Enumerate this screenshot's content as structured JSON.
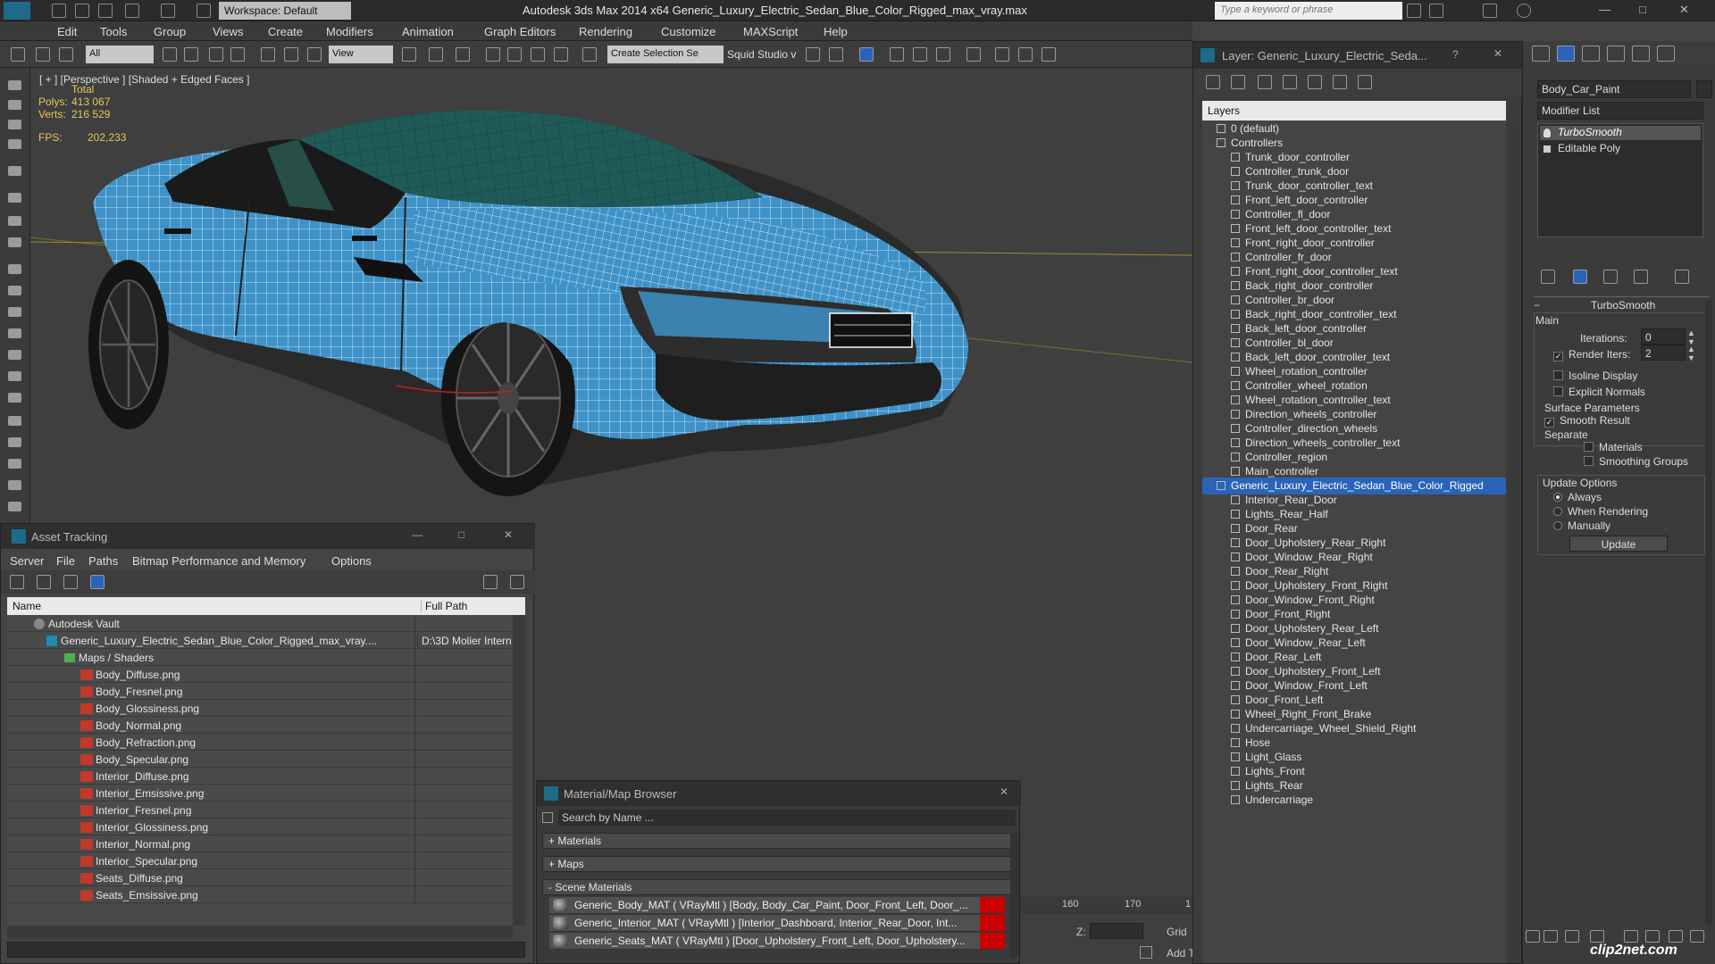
{
  "window": {
    "title": "Autodesk 3ds Max  2014 x64      Generic_Luxury_Electric_Sedan_Blue_Color_Rigged_max_vray.max",
    "workspace": "Workspace: Default",
    "search_placeholder": "Type a keyword or phrase"
  },
  "menu": [
    "Edit",
    "Tools",
    "Group",
    "Views",
    "Create",
    "Modifiers",
    "Animation",
    "Graph Editors",
    "Rendering",
    "Customize",
    "MAXScript",
    "Help"
  ],
  "toolbar": {
    "filter": "All",
    "coord": "View",
    "selection_set": "Create Selection Se",
    "squid": "Squid Studio v"
  },
  "viewport": {
    "label": "[ + ] [Perspective ] [Shaded + Edged Faces ]",
    "total_label": "Total",
    "polys_label": "Polys:",
    "polys_value": "413 067",
    "verts_label": "Verts:",
    "verts_value": "216 529",
    "fps_label": "FPS:",
    "fps_value": "202,233"
  },
  "timeline": {
    "t1": "160",
    "t2": "170",
    "t3": "1",
    "z_label": "Z:",
    "grid_label": "Grid",
    "add_label": "Add T"
  },
  "asset_tracking": {
    "title": "Asset Tracking",
    "menu": [
      "Server",
      "File",
      "Paths",
      "Bitmap Performance and Memory",
      "Options"
    ],
    "col_name": "Name",
    "col_path": "Full Path",
    "vault": "Autodesk Vault",
    "file": "Generic_Luxury_Electric_Sedan_Blue_Color_Rigged_max_vray....",
    "file_path": "D:\\3D Molier Intern",
    "maps_folder": "Maps / Shaders",
    "maps": [
      "Body_Diffuse.png",
      "Body_Fresnel.png",
      "Body_Glossiness.png",
      "Body_Normal.png",
      "Body_Refraction.png",
      "Body_Specular.png",
      "Interior_Diffuse.png",
      "Interior_Emsissive.png",
      "Interior_Fresnel.png",
      "Interior_Glossiness.png",
      "Interior_Normal.png",
      "Interior_Specular.png",
      "Seats_Diffuse.png",
      "Seats_Emsissive.png"
    ]
  },
  "material_browser": {
    "title": "Material/Map Browser",
    "search": "Search by Name ...",
    "materials": "+ Materials",
    "maps": "+ Maps",
    "scene": "- Scene Materials",
    "rows": [
      "Generic_Body_MAT  ( VRayMtl ) [Body, Body_Car_Paint, Door_Front_Left, Door_...",
      "Generic_Interior_MAT  ( VRayMtl ) [Interior_Dashboard, Interior_Rear_Door, Int...",
      "Generic_Seats_MAT  ( VRayMtl ) [Door_Upholstery_Front_Left, Door_Upholstery..."
    ]
  },
  "layers": {
    "title": "Layer: Generic_Luxury_Electric_Seda...",
    "caption": "Layers",
    "items": [
      {
        "t": "0 (default)",
        "lvl": 1
      },
      {
        "t": "Controllers",
        "lvl": 1
      },
      {
        "t": "Trunk_door_controller",
        "lvl": 2
      },
      {
        "t": "Controller_trunk_door",
        "lvl": 2
      },
      {
        "t": "Trunk_door_controller_text",
        "lvl": 2
      },
      {
        "t": "Front_left_door_controller",
        "lvl": 2
      },
      {
        "t": "Controller_fl_door",
        "lvl": 2
      },
      {
        "t": "Front_left_door_controller_text",
        "lvl": 2
      },
      {
        "t": "Front_right_door_controller",
        "lvl": 2
      },
      {
        "t": "Controller_fr_door",
        "lvl": 2
      },
      {
        "t": "Front_right_door_controller_text",
        "lvl": 2
      },
      {
        "t": "Back_right_door_controller",
        "lvl": 2
      },
      {
        "t": "Controller_br_door",
        "lvl": 2
      },
      {
        "t": "Back_right_door_controller_text",
        "lvl": 2
      },
      {
        "t": "Back_left_door_controller",
        "lvl": 2
      },
      {
        "t": "Controller_bl_door",
        "lvl": 2
      },
      {
        "t": "Back_left_door_controller_text",
        "lvl": 2
      },
      {
        "t": "Wheel_rotation_controller",
        "lvl": 2
      },
      {
        "t": "Controller_wheel_rotation",
        "lvl": 2
      },
      {
        "t": "Wheel_rotation_controller_text",
        "lvl": 2
      },
      {
        "t": "Direction_wheels_controller",
        "lvl": 2
      },
      {
        "t": "Controller_direction_wheels",
        "lvl": 2
      },
      {
        "t": "Direction_wheels_controller_text",
        "lvl": 2
      },
      {
        "t": "Controller_region",
        "lvl": 2
      },
      {
        "t": "Main_controller",
        "lvl": 2
      },
      {
        "t": "Generic_Luxury_Electric_Sedan_Blue_Color_Rigged",
        "lvl": 1,
        "sel": true
      },
      {
        "t": "Interior_Rear_Door",
        "lvl": 2
      },
      {
        "t": "Lights_Rear_Half",
        "lvl": 2
      },
      {
        "t": "Door_Rear",
        "lvl": 2
      },
      {
        "t": "Door_Upholstery_Rear_Right",
        "lvl": 2
      },
      {
        "t": "Door_Window_Rear_Right",
        "lvl": 2
      },
      {
        "t": "Door_Rear_Right",
        "lvl": 2
      },
      {
        "t": "Door_Upholstery_Front_Right",
        "lvl": 2
      },
      {
        "t": "Door_Window_Front_Right",
        "lvl": 2
      },
      {
        "t": "Door_Front_Right",
        "lvl": 2
      },
      {
        "t": "Door_Upholstery_Rear_Left",
        "lvl": 2
      },
      {
        "t": "Door_Window_Rear_Left",
        "lvl": 2
      },
      {
        "t": "Door_Rear_Left",
        "lvl": 2
      },
      {
        "t": "Door_Upholstery_Front_Left",
        "lvl": 2
      },
      {
        "t": "Door_Window_Front_Left",
        "lvl": 2
      },
      {
        "t": "Door_Front_Left",
        "lvl": 2
      },
      {
        "t": "Wheel_Right_Front_Brake",
        "lvl": 2
      },
      {
        "t": "Undercarriage_Wheel_Shield_Right",
        "lvl": 2
      },
      {
        "t": "Hose",
        "lvl": 2
      },
      {
        "t": "Light_Glass",
        "lvl": 2
      },
      {
        "t": "Lights_Front",
        "lvl": 2
      },
      {
        "t": "Lights_Rear",
        "lvl": 2
      },
      {
        "t": "Undercarriage",
        "lvl": 2
      }
    ]
  },
  "command_panel": {
    "object_name": "Body_Car_Paint",
    "modifier_list": "Modifier List",
    "stack": [
      "TurboSmooth",
      "Editable Poly"
    ],
    "rollout": "TurboSmooth",
    "main": "Main",
    "iterations_label": "Iterations:",
    "iterations": "0",
    "render_iters_label": "Render Iters:",
    "render_iters": "2",
    "isoline": "Isoline Display",
    "explicit": "Explicit Normals",
    "surface": "Surface Parameters",
    "smooth_result": "Smooth Result",
    "separate": "Separate",
    "materials": "Materials",
    "smoothing_groups": "Smoothing Groups",
    "update_options": "Update Options",
    "always": "Always",
    "when_rendering": "When Rendering",
    "manually": "Manually",
    "update_button": "Update"
  },
  "watermark": "clip2net.com",
  "colors": {
    "car_blue": "#3e92c8",
    "wire": "#ffffff",
    "selected": "#2a63b8",
    "stat": "#e4c85a"
  }
}
